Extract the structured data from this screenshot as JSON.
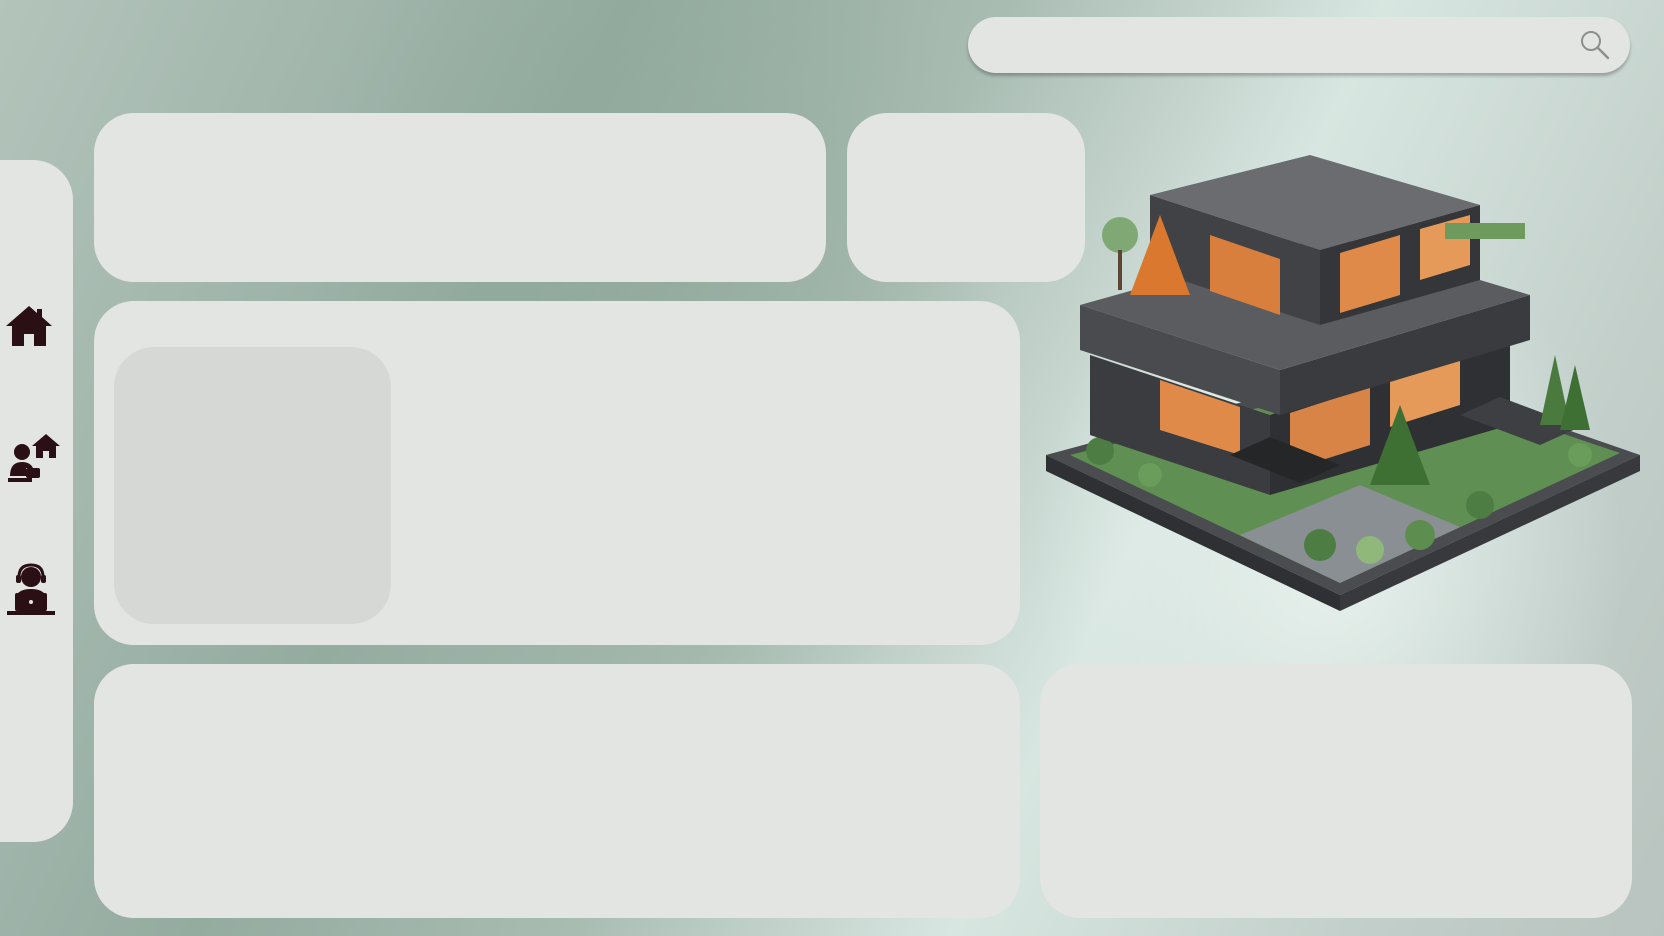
{
  "search": {
    "value": "",
    "placeholder": ""
  },
  "sidebar": {
    "items": [
      {
        "icon": "home-icon"
      },
      {
        "icon": "agent-house-icon"
      },
      {
        "icon": "support-agent-laptop-icon"
      }
    ]
  },
  "colors": {
    "panel": "#e3e5e3",
    "icon": "#2a0f14",
    "background_green": "#94aba0"
  },
  "illustration": {
    "icon": "modern-house-illustration"
  }
}
